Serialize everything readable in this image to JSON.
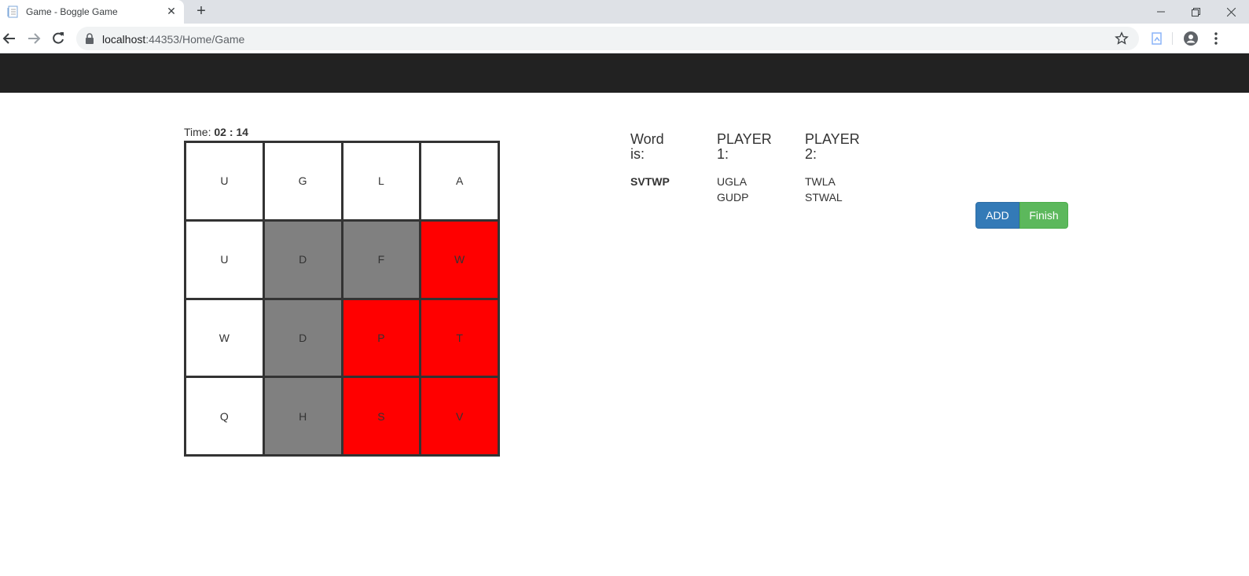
{
  "browser": {
    "tab_title": "Game - Boggle Game",
    "url_host": "localhost",
    "url_path": ":44353/Home/Game"
  },
  "timer": {
    "label": "Time:",
    "value": "02 : 14"
  },
  "board": {
    "cells": [
      {
        "letter": "U",
        "state": "white"
      },
      {
        "letter": "G",
        "state": "white"
      },
      {
        "letter": "L",
        "state": "white"
      },
      {
        "letter": "A",
        "state": "white"
      },
      {
        "letter": "U",
        "state": "white"
      },
      {
        "letter": "D",
        "state": "gray"
      },
      {
        "letter": "F",
        "state": "gray"
      },
      {
        "letter": "W",
        "state": "red"
      },
      {
        "letter": "W",
        "state": "white"
      },
      {
        "letter": "D",
        "state": "gray"
      },
      {
        "letter": "P",
        "state": "red"
      },
      {
        "letter": "T",
        "state": "red"
      },
      {
        "letter": "Q",
        "state": "white"
      },
      {
        "letter": "H",
        "state": "gray"
      },
      {
        "letter": "S",
        "state": "red"
      },
      {
        "letter": "V",
        "state": "red"
      }
    ]
  },
  "word": {
    "heading_line1": "Word",
    "heading_line2": "is:",
    "value": "SVTWP"
  },
  "player1": {
    "heading_line1": "PLAYER",
    "heading_line2": "1:",
    "words": [
      "UGLA",
      "GUDP"
    ]
  },
  "player2": {
    "heading_line1": "PLAYER",
    "heading_line2": "2:",
    "words": [
      "TWLA",
      "STWAL"
    ]
  },
  "actions": {
    "add_label": "ADD",
    "finish_label": "Finish"
  },
  "colors": {
    "navbar": "#222222",
    "selected_cell": "#ff0000",
    "used_cell": "#808080",
    "add_button": "#337ab7",
    "finish_button": "#5cb85c"
  }
}
